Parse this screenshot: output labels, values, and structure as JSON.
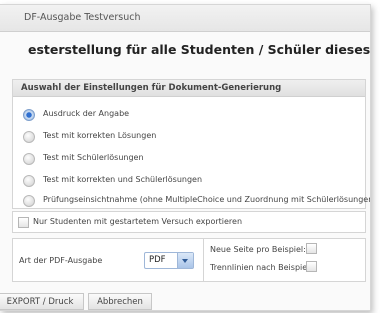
{
  "window": {
    "title": "DF-Ausgabe Testversuch"
  },
  "page_heading": "esterstellung für alle Studenten / Schüler dieses Kurses",
  "settings": {
    "header": "Auswahl der Einstellungen für Dokument-Generierung",
    "options": [
      {
        "label": "Ausdruck der Angabe",
        "selected": true
      },
      {
        "label": "Test mit korrekten Lösungen",
        "selected": false
      },
      {
        "label": "Test mit Schülerlösungen",
        "selected": false
      },
      {
        "label": "Test mit korrekten und Schülerlösungen",
        "selected": false
      },
      {
        "label": "Prüfungseinsichtnahme (ohne MultipleChoice und Zuordnung mit Schülerlösungen)",
        "selected": false
      }
    ]
  },
  "only_started": {
    "label": "Nur Studenten mit gestartetem Versuch exportieren",
    "checked": false
  },
  "output": {
    "type_label": "Art der PDF-Ausgabe",
    "type_value": "PDF",
    "new_page_label": "Neue Seite pro Beispiel:",
    "new_page_checked": false,
    "separators_label": "Trennlinien nach Beispiel:",
    "separators_checked": false
  },
  "actions": {
    "export_label": "EXPORT / Druck",
    "cancel_label": "Abbrechen"
  },
  "colors": {
    "accent": "#2f6fd0",
    "select_border": "#9fb7d8"
  }
}
